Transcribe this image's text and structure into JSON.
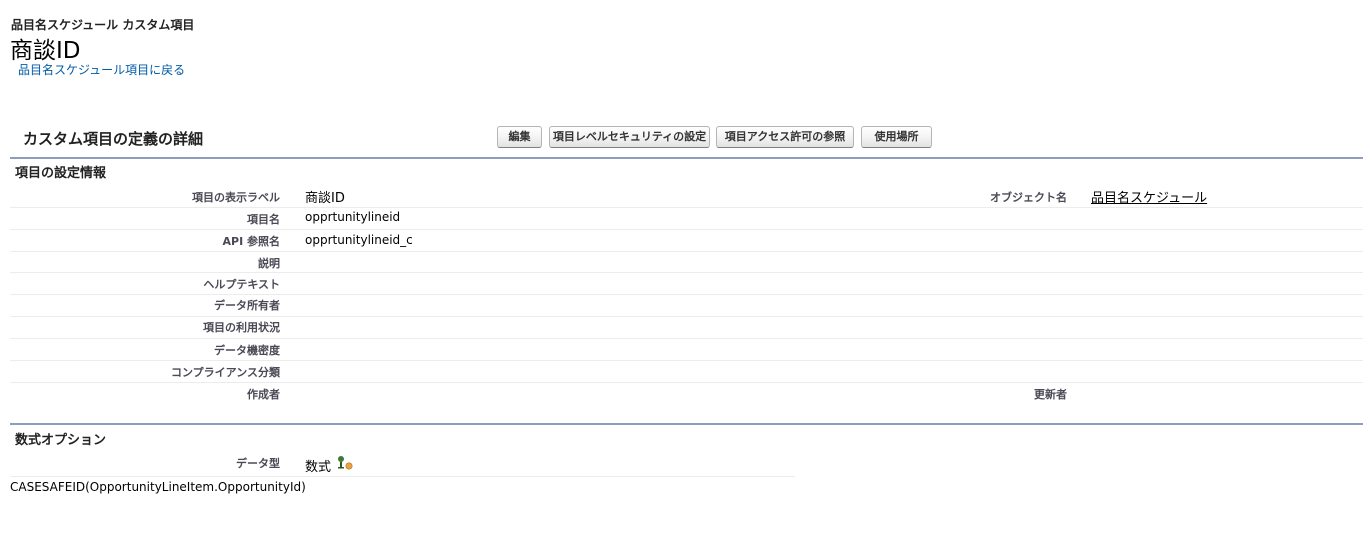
{
  "header": {
    "breadcrumb": "品目名スケジュール カスタム項目",
    "title": "商談ID",
    "back_link": "品目名スケジュール項目に戻る"
  },
  "detail": {
    "section_title": "カスタム項目の定義の詳細",
    "buttons": {
      "edit": "編集",
      "field_security": "項目レベルセキュリティの設定",
      "field_access": "項目アクセス許可の参照",
      "where_used": "使用場所"
    }
  },
  "field_info": {
    "heading": "項目の設定情報",
    "rows": [
      {
        "label": "項目の表示ラベル",
        "value": "商談ID"
      },
      {
        "label": "項目名",
        "value": "opprtunitylineid"
      },
      {
        "label": "API 参照名",
        "value": "opprtunitylineid_c"
      },
      {
        "label": "説明",
        "value": ""
      },
      {
        "label": "ヘルプテキスト",
        "value": ""
      },
      {
        "label": "データ所有者",
        "value": ""
      },
      {
        "label": "項目の利用状況",
        "value": ""
      },
      {
        "label": "データ機密度",
        "value": ""
      },
      {
        "label": "コンプライアンス分類",
        "value": ""
      },
      {
        "label": "作成者",
        "value": ""
      }
    ],
    "object_label": "オブジェクト名",
    "object_value": "品目名スケジュール",
    "modified_label": "更新者",
    "modified_value": ""
  },
  "formula_options": {
    "heading": "数式オプション",
    "data_type_label": "データ型",
    "data_type_value": "数式",
    "formula": "CASESAFEID(OpportunityLineItem.OpportunityId)",
    "info_icon": "formula-help-icon"
  }
}
